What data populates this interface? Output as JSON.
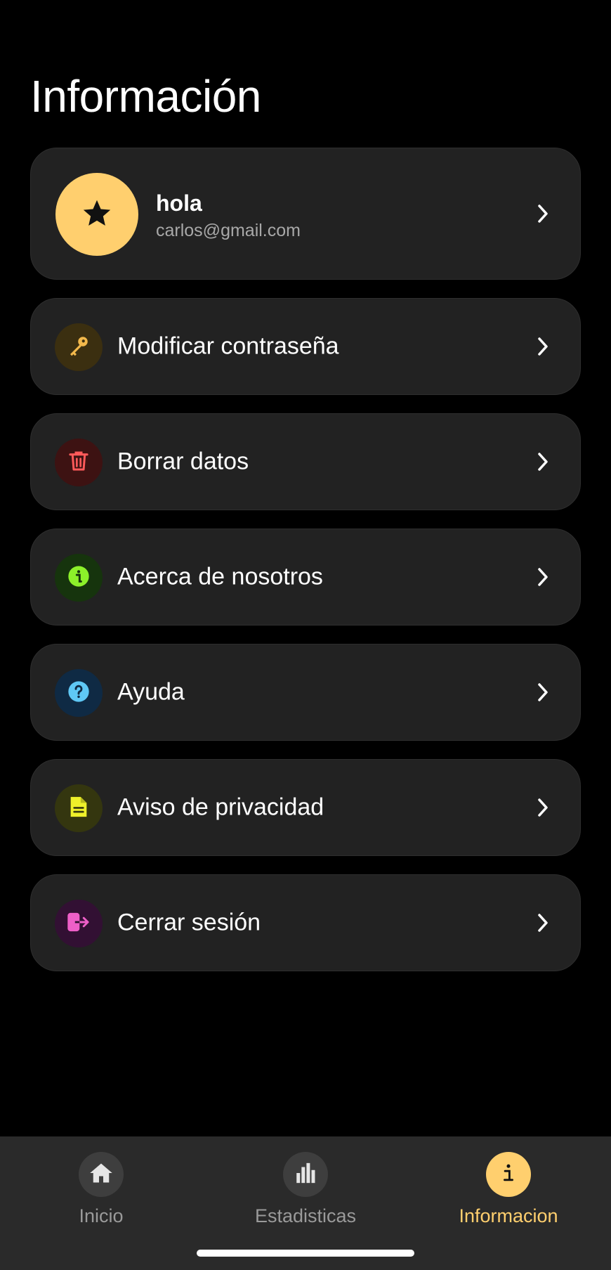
{
  "header": {
    "title": "Información"
  },
  "profile": {
    "name": "hola",
    "email": "carlos@gmail.com",
    "avatar_icon": "star-icon",
    "avatar_color": "#ffcf6e"
  },
  "menu": {
    "items": [
      {
        "label": "Modificar contraseña",
        "icon": "key-icon",
        "icon_color": "#f2b84b",
        "bg": "#3b2f10"
      },
      {
        "label": "Borrar datos",
        "icon": "trash-icon",
        "icon_color": "#ff5a5a",
        "bg": "#3d1212"
      },
      {
        "label": "Acerca de nosotros",
        "icon": "info-icon",
        "icon_color": "#8cf02a",
        "bg": "#16340d"
      },
      {
        "label": "Ayuda",
        "icon": "help-icon",
        "icon_color": "#5fc8f5",
        "bg": "#0f2a44"
      },
      {
        "label": "Aviso de privacidad",
        "icon": "document-icon",
        "icon_color": "#eef02a",
        "bg": "#34360f"
      },
      {
        "label": "Cerrar sesión",
        "icon": "logout-icon",
        "icon_color": "#ee5fc8",
        "bg": "#321033"
      }
    ]
  },
  "tabbar": {
    "tabs": [
      {
        "label": "Inicio",
        "icon": "home-icon"
      },
      {
        "label": "Estadisticas",
        "icon": "bar-chart-icon"
      },
      {
        "label": "Informacion",
        "icon": "info-icon",
        "active": true
      }
    ],
    "active_color": "#ffcf6e"
  }
}
